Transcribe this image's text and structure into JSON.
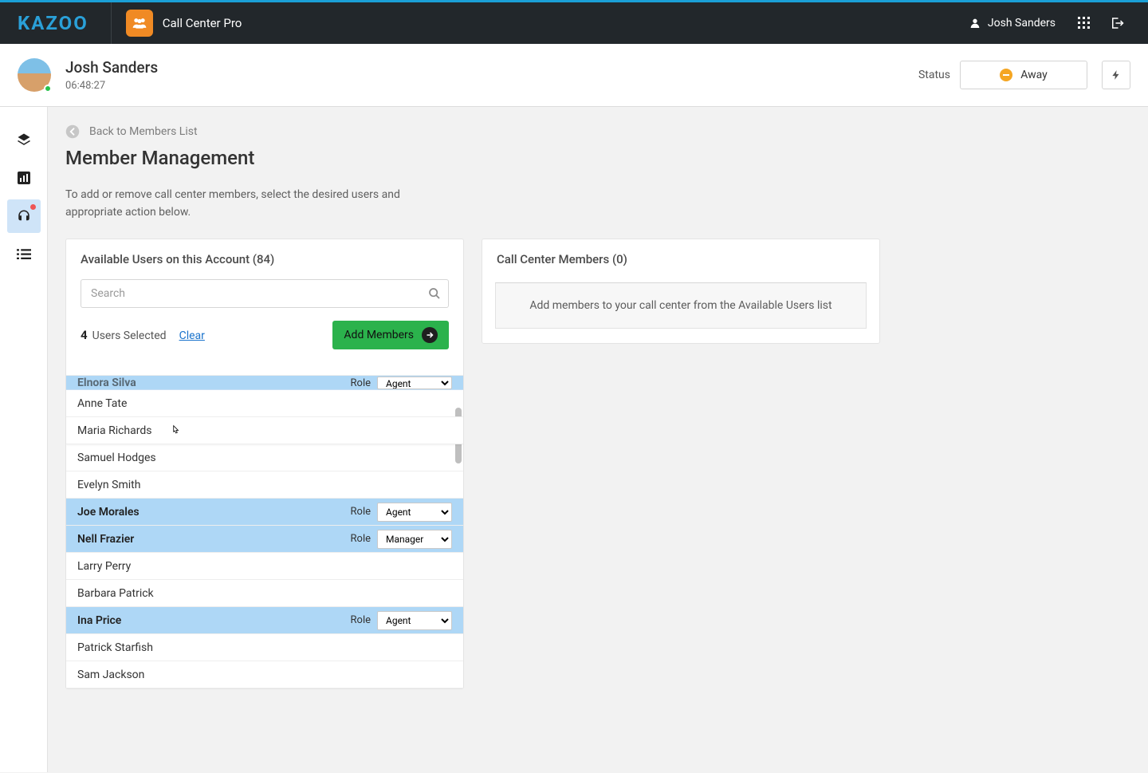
{
  "brand": "KAZOO",
  "app_name": "Call Center Pro",
  "top_user": "Josh Sanders",
  "header": {
    "name": "Josh Sanders",
    "time": "06:48:27",
    "status_label": "Status",
    "status_value": "Away"
  },
  "back_link": "Back to Members List",
  "page_title": "Member Management",
  "page_desc": "To add or remove call center members, select the desired users and appropriate action below.",
  "available_panel": {
    "title_prefix": "Available Users on this Account",
    "count": "(84)",
    "search_placeholder": "Search",
    "selected_count": "4",
    "selected_suffix": "Users Selected",
    "clear": "Clear",
    "add_members": "Add Members",
    "role_label": "Role",
    "partial_user": {
      "name": "Elnora Silva",
      "role": "Agent"
    },
    "users": [
      {
        "name": "Anne Tate",
        "selected": false
      },
      {
        "name": "Maria Richards",
        "selected": false,
        "hover": true
      },
      {
        "name": "Samuel Hodges",
        "selected": false
      },
      {
        "name": "Evelyn Smith",
        "selected": false
      },
      {
        "name": "Joe Morales",
        "selected": true,
        "role": "Agent"
      },
      {
        "name": "Nell Frazier",
        "selected": true,
        "role": "Manager"
      },
      {
        "name": "Larry Perry",
        "selected": false
      },
      {
        "name": "Barbara Patrick",
        "selected": false
      },
      {
        "name": "Ina Price",
        "selected": true,
        "role": "Agent"
      },
      {
        "name": "Patrick Starfish",
        "selected": false
      },
      {
        "name": "Sam Jackson",
        "selected": false
      }
    ],
    "role_options": [
      "Agent",
      "Manager"
    ]
  },
  "members_panel": {
    "title_prefix": "Call Center Members",
    "count": "(0)",
    "empty": "Add members to your call center from the Available Users list"
  },
  "sidebar_items": [
    "layers",
    "bar-chart",
    "headset",
    "list"
  ]
}
